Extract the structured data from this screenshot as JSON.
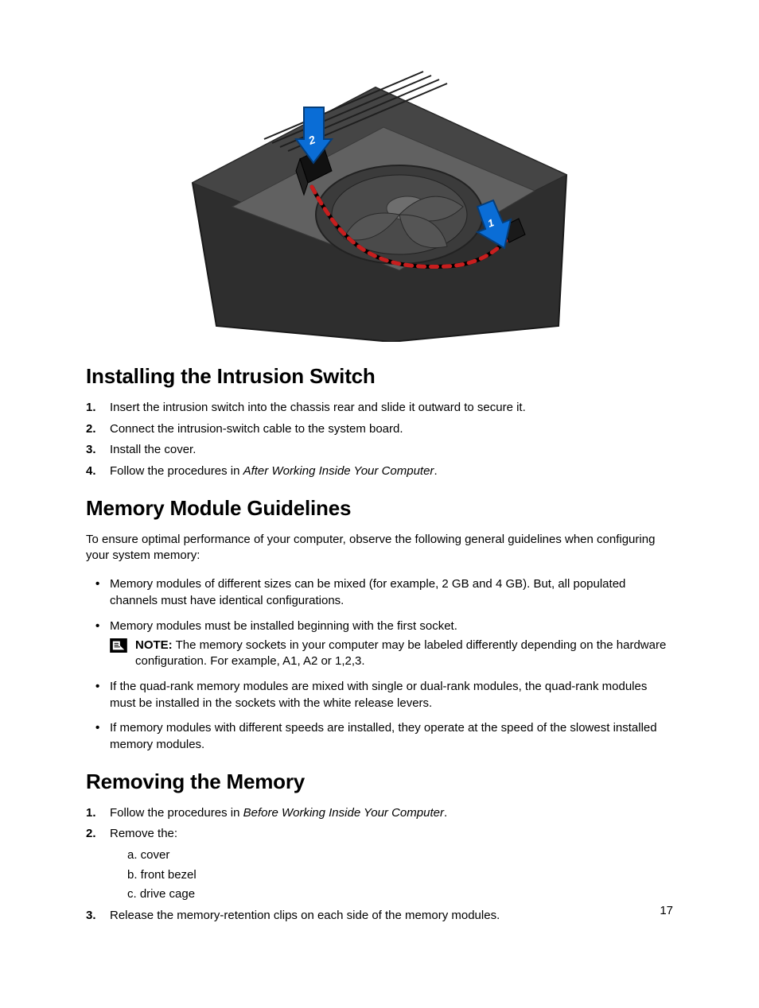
{
  "page_number": "17",
  "figure": {
    "alt": "Intrusion switch installation into chassis with fan and routed cable",
    "callouts": [
      "1",
      "2"
    ]
  },
  "sections": [
    {
      "heading": "Installing the Intrusion Switch",
      "type": "ordered",
      "items": [
        {
          "text": "Insert the intrusion switch into the chassis rear and slide it outward to secure it."
        },
        {
          "text": "Connect the intrusion-switch cable to the system board."
        },
        {
          "text": "Install the cover."
        },
        {
          "text_parts": [
            "Follow the procedures in ",
            {
              "italic": "After Working Inside Your Computer"
            },
            "."
          ]
        }
      ]
    },
    {
      "heading": "Memory Module Guidelines",
      "intro": "To ensure optimal performance of your computer, observe the following general guidelines when configuring your system memory:",
      "type": "bullets",
      "items": [
        {
          "text": "Memory modules of different sizes can be mixed (for example, 2 GB and 4 GB). But, all populated channels must have identical configurations."
        },
        {
          "text": "Memory modules must be installed beginning with the first socket.",
          "note": {
            "label": "NOTE:",
            "text": "The memory sockets in your computer may be labeled differently depending on the hardware configuration. For example, A1, A2 or 1,2,3."
          }
        },
        {
          "text": "If the quad-rank memory modules are mixed with single or dual-rank modules, the quad-rank modules must be installed in the sockets with the white release levers."
        },
        {
          "text": "If memory modules with different speeds are installed, they operate at the speed of the slowest installed memory modules."
        }
      ]
    },
    {
      "heading": "Removing the Memory",
      "type": "ordered",
      "items": [
        {
          "text_parts": [
            "Follow the procedures in ",
            {
              "italic": "Before Working Inside Your Computer"
            },
            "."
          ]
        },
        {
          "text": "Remove the:",
          "sublist": [
            "a.   cover",
            "b.   front bezel",
            "c.   drive cage"
          ]
        },
        {
          "text": "Release the memory-retention clips on each side of the memory modules."
        }
      ]
    }
  ]
}
